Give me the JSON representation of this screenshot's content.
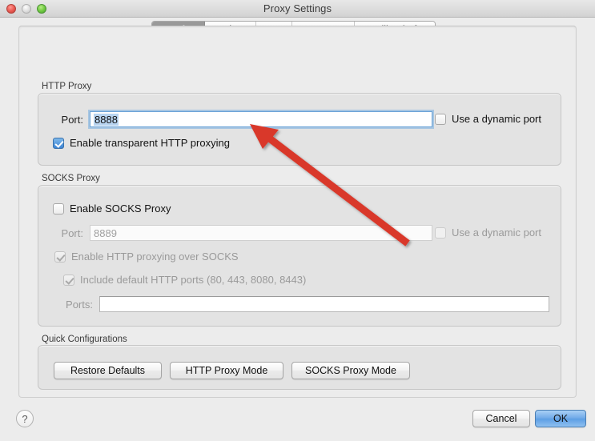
{
  "window": {
    "title": "Proxy Settings",
    "traffic_lights": [
      "close-button",
      "minimize-button",
      "zoom-button"
    ]
  },
  "tabs": [
    {
      "label": "Proxies",
      "active": true
    },
    {
      "label": "Options",
      "active": false
    },
    {
      "label": "SSL",
      "active": false
    },
    {
      "label": "Mac OS X",
      "active": false
    },
    {
      "label": "Mozilla Firefox",
      "active": false
    }
  ],
  "http_proxy": {
    "group_label": "HTTP Proxy",
    "port_label": "Port:",
    "port_value": "8888",
    "port_placeholder": "",
    "dynamic_port_label": "Use a dynamic port",
    "dynamic_port_checked": false,
    "transparent_label": "Enable transparent HTTP proxying",
    "transparent_checked": true
  },
  "socks_proxy": {
    "group_label": "SOCKS Proxy",
    "enable_label": "Enable SOCKS Proxy",
    "enable_checked": false,
    "port_label": "Port:",
    "port_value": "8889",
    "dynamic_port_label": "Use a dynamic port",
    "dynamic_port_checked": false,
    "http_over_socks_label": "Enable HTTP proxying over SOCKS",
    "http_over_socks_checked": true,
    "default_ports_label": "Include default HTTP ports (80, 443, 8080, 8443)",
    "default_ports_checked": true,
    "ports_label": "Ports:",
    "ports_value": "",
    "ports_placeholder": ""
  },
  "quick_configurations": {
    "group_label": "Quick Configurations",
    "buttons": [
      {
        "label": "Restore Defaults"
      },
      {
        "label": "HTTP Proxy Mode"
      },
      {
        "label": "SOCKS Proxy Mode"
      }
    ]
  },
  "footer": {
    "help_label": "?",
    "cancel_label": "Cancel",
    "ok_label": "OK"
  },
  "annotation": {
    "arrow_color": "#d9372b",
    "points_at": "enable-transparent-http-proxying-checkbox"
  },
  "colors": {
    "accent_blue": "#3c84d4",
    "default_button_blue": "#6fa9e8",
    "selection_blue": "#b8d4f0",
    "window_bg": "#ececec",
    "group_bg": "#e3e3e3",
    "annotation_red": "#d9372b"
  }
}
